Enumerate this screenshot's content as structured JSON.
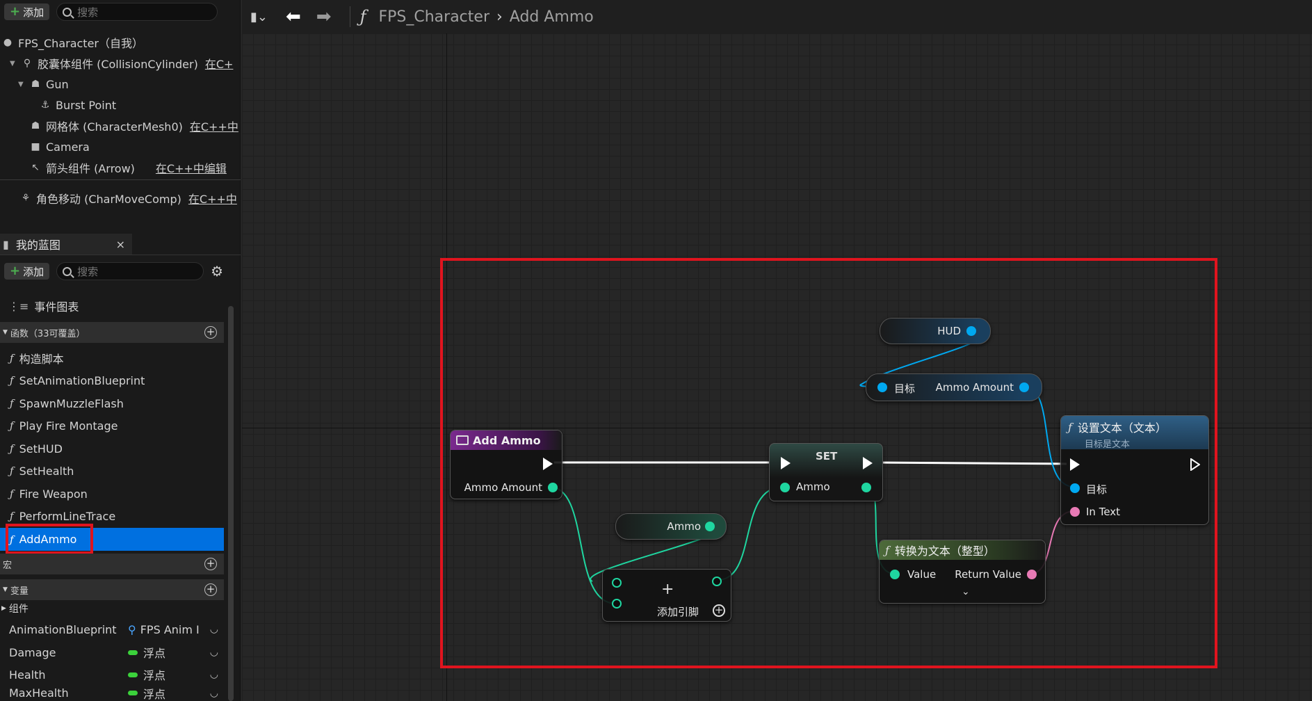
{
  "left_panel": {
    "components_toolbar": {
      "add_label": "添加",
      "search_placeholder": "搜索"
    },
    "components": [
      {
        "label": "FPS_Character（自我）"
      },
      {
        "label": "胶囊体组件 (CollisionCylinder)",
        "edit": "在C+"
      },
      {
        "label": "Gun"
      },
      {
        "label": "Burst Point"
      },
      {
        "label": "网格体 (CharacterMesh0)",
        "edit": "在C++中"
      },
      {
        "label": "Camera"
      },
      {
        "label": "箭头组件 (Arrow)",
        "edit": "在C++中编辑"
      },
      {
        "label": "角色移动 (CharMoveComp)",
        "edit": "在C++中"
      }
    ],
    "my_blueprint": {
      "tab_label": "我的蓝图",
      "close": "×",
      "add_label": "添加",
      "search_placeholder": "搜索",
      "event_graph": "事件图表",
      "functions_header": "函数（33可覆盖）",
      "functions": [
        "构造脚本",
        "SetAnimationBlueprint",
        "SpawnMuzzleFlash",
        "Play Fire Montage",
        "SetHUD",
        "SetHealth",
        "Fire Weapon",
        "PerformLineTrace",
        "AddAmmo"
      ],
      "macros_header": "宏",
      "variables_header": "变量",
      "components_group": "组件",
      "variables": [
        {
          "name": "AnimationBlueprint",
          "type": "FPS Anim I"
        },
        {
          "name": "Damage",
          "type": "浮点"
        },
        {
          "name": "Health",
          "type": "浮点"
        },
        {
          "name": "MaxHealth",
          "type": "浮点"
        }
      ]
    }
  },
  "breadcrumb": {
    "fx": "ƒ",
    "blueprint": "FPS_Character",
    "function": "Add Ammo"
  },
  "graph": {
    "nodes": {
      "add_ammo": {
        "title": "Add Ammo",
        "pin": "Ammo Amount"
      },
      "ammo_get": {
        "pin": "Ammo"
      },
      "add_pin_node": {
        "label": "添加引脚"
      },
      "set": {
        "title": "SET",
        "pin": "Ammo"
      },
      "hud_get": {
        "pin": "HUD"
      },
      "ammo_amount_get": {
        "target": "目标",
        "pin": "Ammo Amount"
      },
      "to_text": {
        "title": "转换为文本（整型）",
        "in": "Value",
        "out": "Return Value"
      },
      "set_text": {
        "title": "设置文本（文本）",
        "subtitle": "目标是文本",
        "target": "目标",
        "in_text": "In Text"
      }
    }
  },
  "colors": {
    "accent_selected": "#0070e0",
    "highlight_box": "#e0141e",
    "exec_wire": "#ffffff",
    "int_pin": "#1fd6a0",
    "object_pin": "#00a8f0",
    "text_pin": "#e87ab5"
  }
}
